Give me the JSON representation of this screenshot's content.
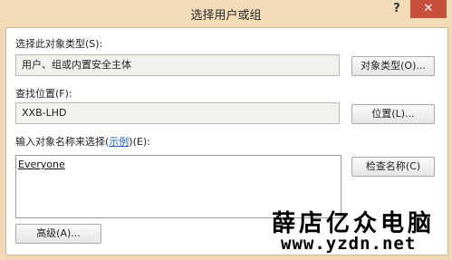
{
  "window": {
    "title": "选择用户或组",
    "help_glyph": "?",
    "close_glyph": "✕"
  },
  "object_type": {
    "label": "选择此对象类型(S):",
    "value": "用户、组或内置安全主体",
    "button": "对象类型(O)..."
  },
  "location": {
    "label": "查找位置(F):",
    "value": "XXB-LHD",
    "button": "位置(L)..."
  },
  "names": {
    "label_prefix": "输入对象名称来选择(",
    "label_link": "示例",
    "label_suffix": ")(E):",
    "entry": "Everyone",
    "check_button": "检查名称(C)"
  },
  "advanced_button": "高级(A)...",
  "watermark": {
    "line1": "薛店亿众电脑",
    "line2": "www.yzdn.net"
  }
}
